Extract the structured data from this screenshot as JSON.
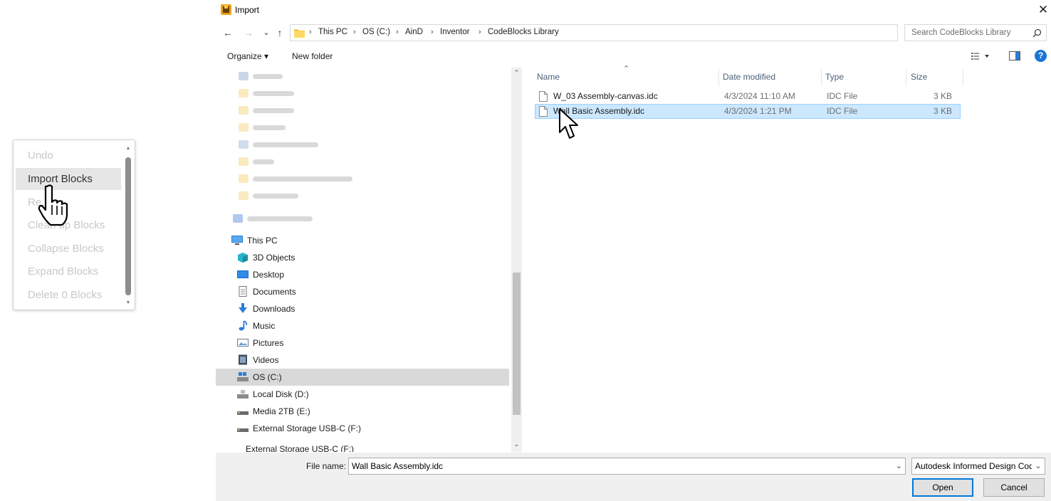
{
  "context_menu": {
    "items": [
      {
        "label": "Undo",
        "state": "disabled"
      },
      {
        "label": "Import Blocks",
        "state": "hover"
      },
      {
        "label": "Re",
        "state": "disabled"
      },
      {
        "label": "Clean up Blocks",
        "state": "disabled"
      },
      {
        "label": "Collapse Blocks",
        "state": "disabled"
      },
      {
        "label": "Expand Blocks",
        "state": "disabled"
      },
      {
        "label": "Delete 0 Blocks",
        "state": "disabled"
      }
    ]
  },
  "dialog": {
    "title": "Import",
    "close_glyph": "✕",
    "nav": {
      "back": "←",
      "forward": "→",
      "recent": "⌄",
      "up": "↑"
    },
    "breadcrumbs": [
      "This PC",
      "OS (C:)",
      "AinD",
      "Inventor",
      "CodeBlocks Library"
    ],
    "search_placeholder": "Search CodeBlocks Library",
    "toolbar": {
      "organize": "Organize ▾",
      "new_folder": "New folder",
      "help": "?"
    },
    "nav_tree": [
      {
        "label": "This PC",
        "icon": "pc-icon"
      },
      {
        "label": "3D Objects",
        "icon": "cube-icon"
      },
      {
        "label": "Desktop",
        "icon": "desktop-icon"
      },
      {
        "label": "Documents",
        "icon": "document-icon"
      },
      {
        "label": "Downloads",
        "icon": "download-icon"
      },
      {
        "label": "Music",
        "icon": "music-icon"
      },
      {
        "label": "Pictures",
        "icon": "pictures-icon"
      },
      {
        "label": "Videos",
        "icon": "videos-icon"
      },
      {
        "label": "OS (C:)",
        "icon": "os-drive-icon",
        "selected": true
      },
      {
        "label": "Local Disk (D:)",
        "icon": "disk-icon"
      },
      {
        "label": "Media 2TB (E:)",
        "icon": "drive-icon"
      },
      {
        "label": "External Storage USB-C (F:)",
        "icon": "drive-icon"
      },
      {
        "label": "External Storage USB-C (F:)",
        "icon": "none"
      }
    ],
    "columns": [
      "Name",
      "Date modified",
      "Type",
      "Size"
    ],
    "files": [
      {
        "name": "W_03 Assembly-canvas.idc",
        "date": "4/3/2024 11:10 AM",
        "type": "IDC File",
        "size": "3 KB",
        "selected": false
      },
      {
        "name": "Wall Basic Assembly.idc",
        "date": "4/3/2024 1:21 PM",
        "type": "IDC File",
        "size": "3 KB",
        "selected": true
      }
    ],
    "footer": {
      "file_name_label": "File name:",
      "file_name_value": "Wall Basic Assembly.idc",
      "file_type_value": "Autodesk Informed Design Code",
      "open_label": "Open",
      "cancel_label": "Cancel"
    }
  },
  "colors": {
    "selection": "#cce8ff",
    "accent": "#0078d7",
    "header_text": "#4c607a"
  }
}
